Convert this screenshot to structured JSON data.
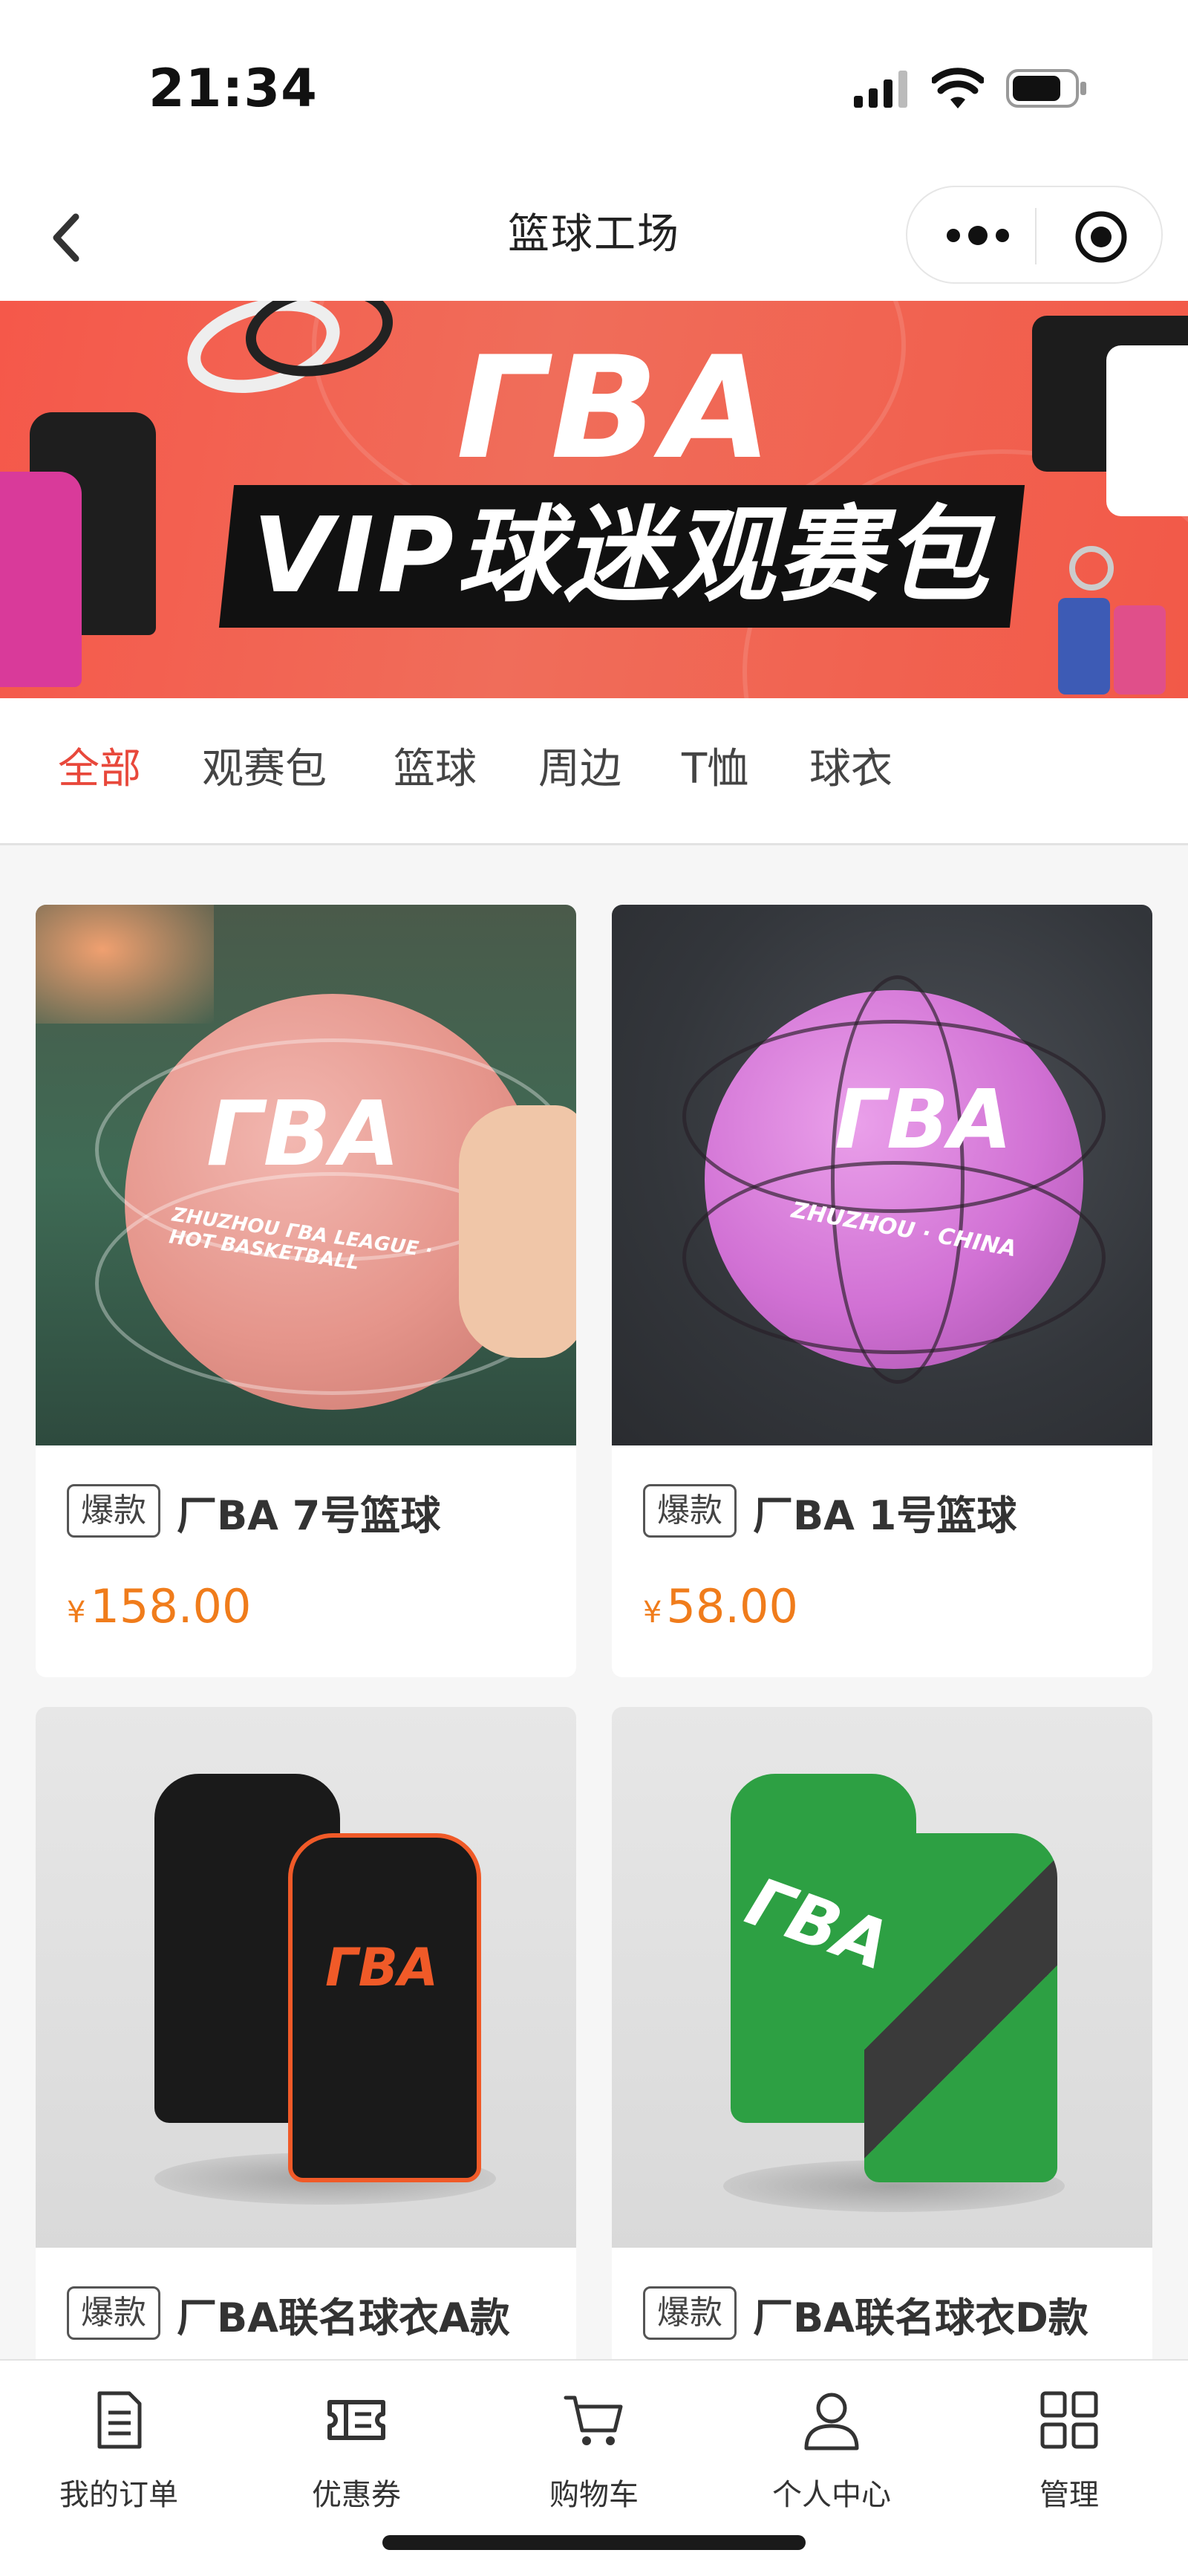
{
  "status_bar": {
    "time": "21:34"
  },
  "nav": {
    "title": "篮球工场"
  },
  "banner": {
    "logo": "ΓBA",
    "headline": "VIP球迷观赛包"
  },
  "tabs": [
    {
      "label": "全部",
      "active": true
    },
    {
      "label": "观赛包",
      "active": false
    },
    {
      "label": "篮球",
      "active": false
    },
    {
      "label": "周边",
      "active": false
    },
    {
      "label": "T恤",
      "active": false
    },
    {
      "label": "球衣",
      "active": false
    }
  ],
  "products": [
    {
      "badge": "爆款",
      "name": "厂BA 7号篮球",
      "currency": "¥",
      "price": "158.00",
      "ball_text": "ZHUZHOU ΓBA LEAGUE · HOT BASKETBALL"
    },
    {
      "badge": "爆款",
      "name": "厂BA 1号篮球",
      "currency": "¥",
      "price": "58.00",
      "ball_text": "ZHUZHOU · CHINA"
    },
    {
      "badge": "爆款",
      "name": "厂BA联名球衣A款"
    },
    {
      "badge": "爆款",
      "name": "厂BA联名球衣D款"
    }
  ],
  "tabbar": [
    {
      "label": "我的订单",
      "icon": "document-icon"
    },
    {
      "label": "优惠券",
      "icon": "ticket-icon"
    },
    {
      "label": "购物车",
      "icon": "cart-icon"
    },
    {
      "label": "个人中心",
      "icon": "person-icon"
    },
    {
      "label": "管理",
      "icon": "grid-icon"
    }
  ],
  "colors": {
    "accent": "#e8483b",
    "price": "#f07c1b",
    "banner": "#f25948"
  }
}
